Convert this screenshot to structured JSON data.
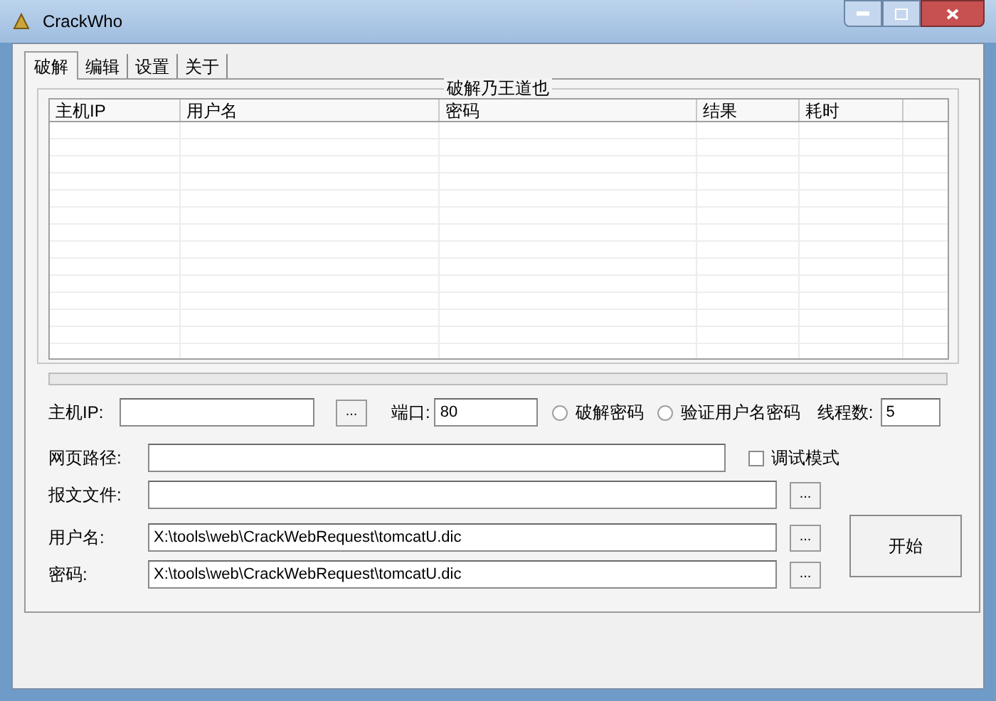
{
  "window": {
    "title": "CrackWho"
  },
  "tabs": [
    {
      "label": "破解",
      "selected": true
    },
    {
      "label": "编辑",
      "selected": false
    },
    {
      "label": "设置",
      "selected": false
    },
    {
      "label": "关于",
      "selected": false
    }
  ],
  "group": {
    "title": "破解乃王道也"
  },
  "table": {
    "columns": [
      "主机IP",
      "用户名",
      "密码",
      "结果",
      "耗时"
    ]
  },
  "progress": {
    "level": 0
  },
  "form": {
    "host_label": "主机IP:",
    "host_browse": "...",
    "port_label": "端口:",
    "port_value": "80",
    "radios": [
      {
        "label": "破解密码",
        "selected": false
      },
      {
        "label": "验证用户名密码",
        "selected": false
      }
    ],
    "threads_label": "线程数:",
    "threads_value": "5",
    "path_label": "网页路径:",
    "debug": {
      "label": "调试模式",
      "checked": false
    },
    "packet_label": "报文文件:",
    "packet_browse": "...",
    "user_label": "用户名:",
    "user_value": "X:\\tools\\web\\CrackWebRequest\\tomcatU.dic",
    "user_browse": "...",
    "pass_label": "密码:",
    "pass_value": "X:\\tools\\web\\CrackWebRequest\\tomcatU.dic",
    "pass_browse": "...",
    "start": "开始"
  }
}
